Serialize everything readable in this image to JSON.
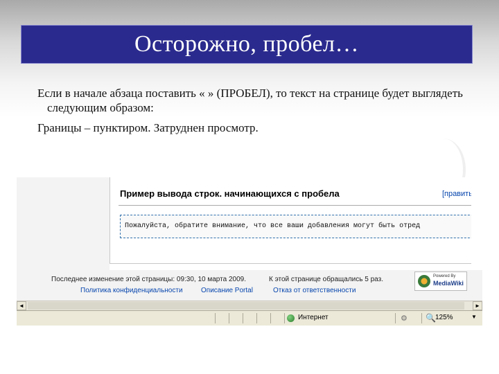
{
  "slide": {
    "title": "Осторожно, пробел…",
    "paragraph1": "Если в начале абзаца поставить « » (ПРОБЕЛ), то текст на странице будет выглядеть следующим образом:",
    "paragraph2": "Границы – пунктиром. Затруднен просмотр."
  },
  "page": {
    "heading": "Пример вывода строк. начинающихся с пробела",
    "edit_link": "[править]",
    "preformatted": "Пожалуйста, обратите внимание, что все ваши добавления могут быть отред"
  },
  "footer": {
    "last_modified": "Последнее изменение этой страницы: 09:30, 10 марта 2009.",
    "views": "К этой странице обращались 5 раз.",
    "privacy_link": "Политика конфиденциальности",
    "about_link": "Описание Portal",
    "disclaimer_link": "Отказ от ответственности",
    "badge_small": "Powered By",
    "badge_name": "MediaWiki"
  },
  "scroll": {
    "left_arrow": "◄",
    "right_arrow": "►"
  },
  "status": {
    "zone": "Интернет",
    "zoom": "125%",
    "zoom_dropdown": "▼"
  },
  "colors": {
    "title_bar": "#2a2a8e",
    "link": "#0645ad",
    "dashed_border": "#2f6fab"
  }
}
